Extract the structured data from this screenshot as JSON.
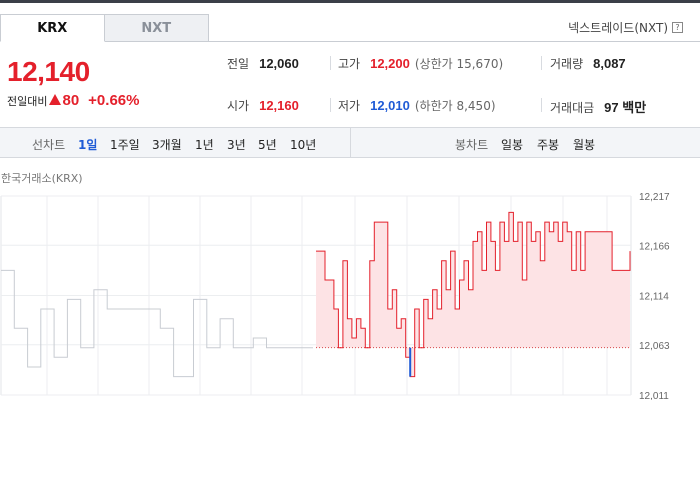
{
  "tabs": [
    {
      "label": "KRX",
      "active": true
    },
    {
      "label": "NXT",
      "active": false
    }
  ],
  "exchange_label": "넥스트레이드(NXT)",
  "help_icon": "?",
  "price": {
    "current": "12,140",
    "change_label": "전일대비",
    "change": "80",
    "change_pct": "+0.66%",
    "direction": "up-icon"
  },
  "stats": {
    "prev_close_label": "전일",
    "prev_close": "12,060",
    "open_label": "시가",
    "open": "12,160",
    "high_label": "고가",
    "high": "12,200",
    "upper_limit": "(상한가 15,670)",
    "low_label": "저가",
    "low": "12,010",
    "lower_limit": "(하한가 8,450)",
    "volume_label": "거래량",
    "volume": "8,087",
    "value_label": "거래대금",
    "value": "97 백만"
  },
  "period_bar": {
    "line_label": "선차트",
    "line_periods": [
      "1일",
      "1주일",
      "3개월",
      "1년",
      "3년",
      "5년",
      "10년"
    ],
    "active_period": "1일",
    "candle_label": "봉차트",
    "candle_periods": [
      "일봉",
      "주봉",
      "월봉"
    ]
  },
  "chart_data": {
    "type": "line",
    "source": "한국거래소(KRX)",
    "y_ticks": [
      "12,217",
      "12,166",
      "12,114",
      "12,063",
      "12,011"
    ],
    "ylim": [
      12011,
      12217
    ],
    "prev_close": 12060,
    "colors": {
      "up_line": "#e4202b",
      "up_fill": "#fde3e5",
      "down_line": "#1f5bd6",
      "prev_series": "#c8ccd2"
    },
    "prev_day_series": [
      12140,
      12140,
      12080,
      12080,
      12040,
      12040,
      12100,
      12100,
      12050,
      12050,
      12110,
      12110,
      12060,
      12060,
      12120,
      12120,
      12100,
      12100,
      12100,
      12100,
      12100,
      12100,
      12100,
      12100,
      12080,
      12080,
      12030,
      12030,
      12030,
      12110,
      12110,
      12060,
      12060,
      12090,
      12090,
      12060,
      12060,
      12060,
      12070,
      12070,
      12060,
      12060,
      12060,
      12060,
      12060,
      12060,
      12060,
      12060
    ],
    "today_series": [
      12160,
      12160,
      12130,
      12130,
      12100,
      12060,
      12150,
      12090,
      12070,
      12090,
      12080,
      12060,
      12150,
      12190,
      12190,
      12190,
      12100,
      12120,
      12080,
      12090,
      12050,
      12030,
      12100,
      12060,
      12110,
      12090,
      12120,
      12100,
      12150,
      12120,
      12160,
      12100,
      12130,
      12150,
      12120,
      12170,
      12180,
      12140,
      12190,
      12170,
      12140,
      12190,
      12170,
      12200,
      12170,
      12190,
      12130,
      12190,
      12170,
      12180,
      12150,
      12190,
      12180,
      12190,
      12170,
      12190,
      12180,
      12140,
      12180,
      12140,
      12180,
      12180,
      12180,
      12180,
      12180,
      12180,
      12140,
      12140,
      12140,
      12140,
      12160
    ]
  }
}
